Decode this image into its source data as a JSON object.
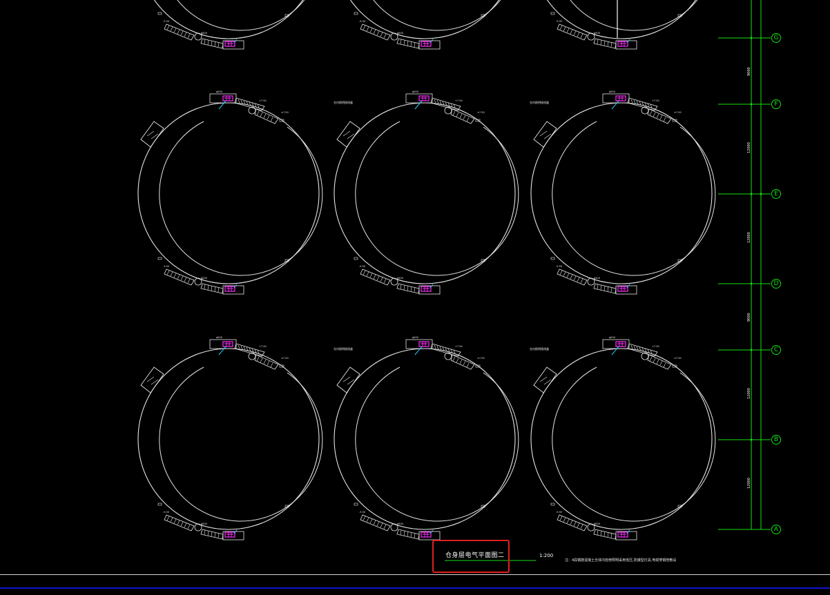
{
  "drawing": {
    "title": "仓身层电气平面图二",
    "scale": "1:200",
    "note": "注：4段钢筋混凝土仓体内检修照明采用低压,防爆型灯具,电缆穿钢管敷设"
  },
  "axes": [
    {
      "label": "G"
    },
    {
      "label": "F"
    },
    {
      "label": "E"
    },
    {
      "label": "D"
    },
    {
      "label": "C"
    },
    {
      "label": "B"
    },
    {
      "label": "A"
    }
  ],
  "dimensions": [
    "9000",
    "12000",
    "12000",
    "9000",
    "12000",
    "12000"
  ],
  "colors": {
    "background": "#000000",
    "linework": "#e6e6e6",
    "axis": "#18e018",
    "equipment": "#ff30ff",
    "conduit": "#20d0ff",
    "highlight": "#e02020",
    "status_bar": "#1414d0"
  }
}
